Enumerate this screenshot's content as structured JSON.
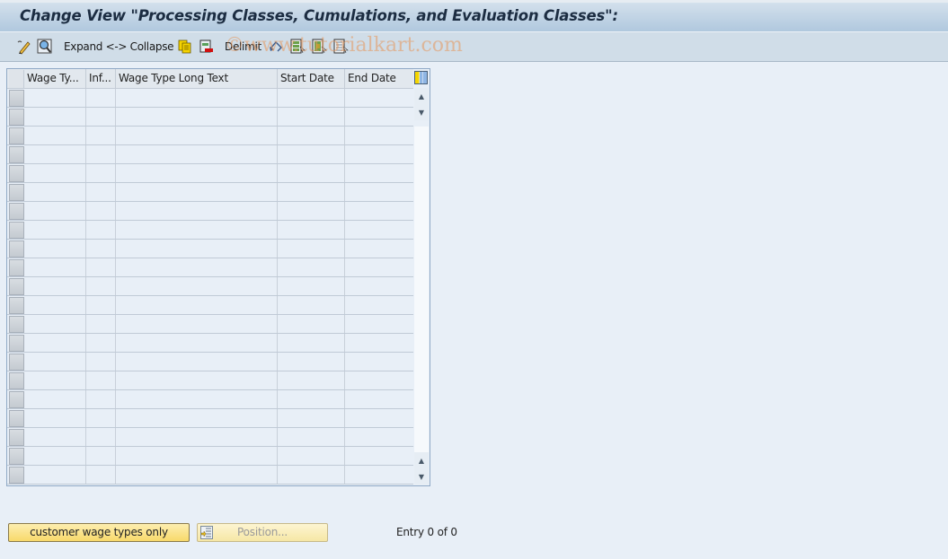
{
  "window": {
    "title": "Change View \"Processing Classes, Cumulations, and Evaluation Classes\":"
  },
  "toolbar": {
    "items": [
      {
        "icon": "display-change-icon"
      },
      {
        "icon": "find-icon"
      },
      {
        "label": "Expand <-> Collapse"
      },
      {
        "icon": "copy-icon"
      },
      {
        "icon": "delete-icon"
      },
      {
        "label": "Delimit"
      },
      {
        "icon": "undo-change-icon"
      },
      {
        "icon": "select-all-icon"
      },
      {
        "icon": "select-block-icon"
      },
      {
        "icon": "deselect-all-icon"
      }
    ],
    "expand_collapse_label": "Expand <-> Collapse",
    "delimit_label": "Delimit"
  },
  "watermark": "©www.tutorialkart.com",
  "table": {
    "columns": [
      {
        "label": "Wage Ty..."
      },
      {
        "label": "Inf..."
      },
      {
        "label": "Wage Type Long Text"
      },
      {
        "label": "Start Date"
      },
      {
        "label": "End Date"
      }
    ],
    "rows": [
      [
        "",
        "",
        "",
        "",
        ""
      ],
      [
        "",
        "",
        "",
        "",
        ""
      ],
      [
        "",
        "",
        "",
        "",
        ""
      ],
      [
        "",
        "",
        "",
        "",
        ""
      ],
      [
        "",
        "",
        "",
        "",
        ""
      ],
      [
        "",
        "",
        "",
        "",
        ""
      ],
      [
        "",
        "",
        "",
        "",
        ""
      ],
      [
        "",
        "",
        "",
        "",
        ""
      ],
      [
        "",
        "",
        "",
        "",
        ""
      ],
      [
        "",
        "",
        "",
        "",
        ""
      ],
      [
        "",
        "",
        "",
        "",
        ""
      ],
      [
        "",
        "",
        "",
        "",
        ""
      ],
      [
        "",
        "",
        "",
        "",
        ""
      ],
      [
        "",
        "",
        "",
        "",
        ""
      ],
      [
        "",
        "",
        "",
        "",
        ""
      ],
      [
        "",
        "",
        "",
        "",
        ""
      ],
      [
        "",
        "",
        "",
        "",
        ""
      ],
      [
        "",
        "",
        "",
        "",
        ""
      ],
      [
        "",
        "",
        "",
        "",
        ""
      ],
      [
        "",
        "",
        "",
        "",
        ""
      ],
      [
        "",
        "",
        "",
        "",
        ""
      ]
    ]
  },
  "footer": {
    "customer_button_label": "customer wage types only",
    "position_button_label": "Position...",
    "entry_text": "Entry 0 of 0"
  }
}
